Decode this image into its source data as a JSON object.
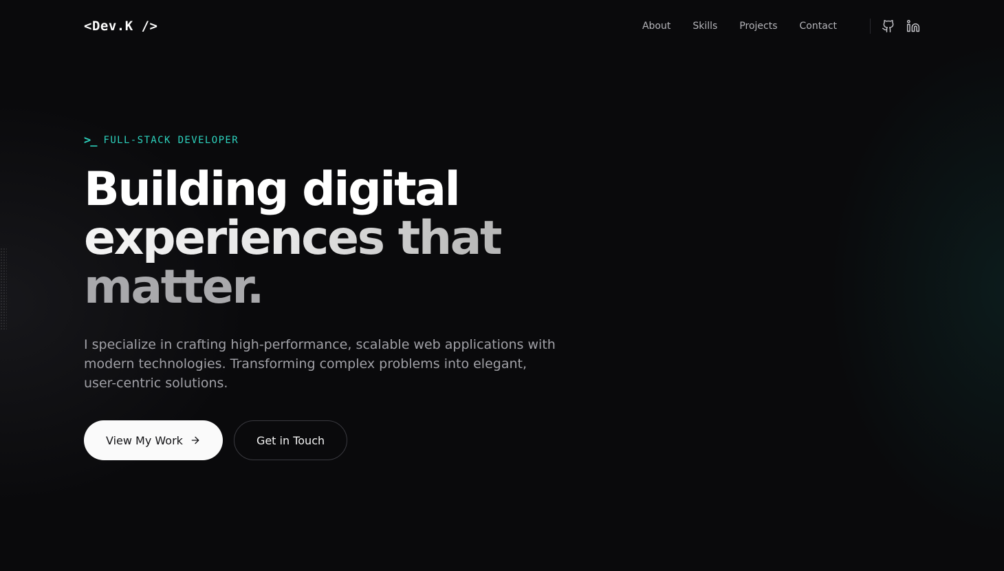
{
  "brand": {
    "logo_text": "<Dev.K />"
  },
  "nav": {
    "links": [
      {
        "label": "About"
      },
      {
        "label": "Skills"
      },
      {
        "label": "Projects"
      },
      {
        "label": "Contact"
      }
    ],
    "social": [
      {
        "icon": "github-icon"
      },
      {
        "icon": "linkedin-icon"
      }
    ]
  },
  "hero": {
    "role_icon": ">_",
    "role": "FULL-STACK DEVELOPER",
    "headline": {
      "line1": "Building digital",
      "line2": "experiences that",
      "line3": "matter."
    },
    "description": "I specialize in crafting high-performance, scalable web applications with modern technologies. Transforming complex problems into elegant, user-centric solutions.",
    "primary_cta": "View My Work",
    "secondary_cta": "Get in Touch"
  },
  "colors": {
    "background": "#0a0a0c",
    "accent": "#2dd4bf",
    "text_primary": "#ffffff",
    "text_muted": "#a1a1a7",
    "button_primary_bg": "#fafafa"
  }
}
